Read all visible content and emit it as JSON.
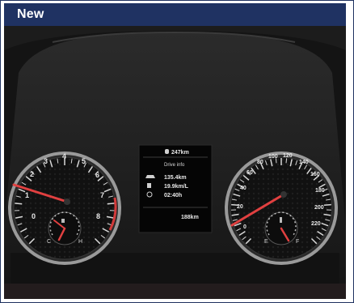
{
  "header": {
    "title": "New"
  },
  "cluster": {
    "tachometer": {
      "labels": [
        "0",
        "1",
        "2",
        "3",
        "4",
        "5",
        "6",
        "7",
        "8"
      ]
    },
    "speedometer": {
      "labels": [
        "0",
        "20",
        "40",
        "60",
        "80",
        "100",
        "120",
        "140",
        "160",
        "180",
        "200",
        "220"
      ]
    },
    "fuel_gauge": {
      "low": "E",
      "high": "F"
    },
    "temp_gauge": {
      "low": "C",
      "high": "H"
    },
    "display": {
      "range": "247km",
      "heading": "Drive info",
      "distance": "135.4km",
      "economy": "19.9km/L",
      "time": "02:40h",
      "odometer": "188km"
    }
  }
}
